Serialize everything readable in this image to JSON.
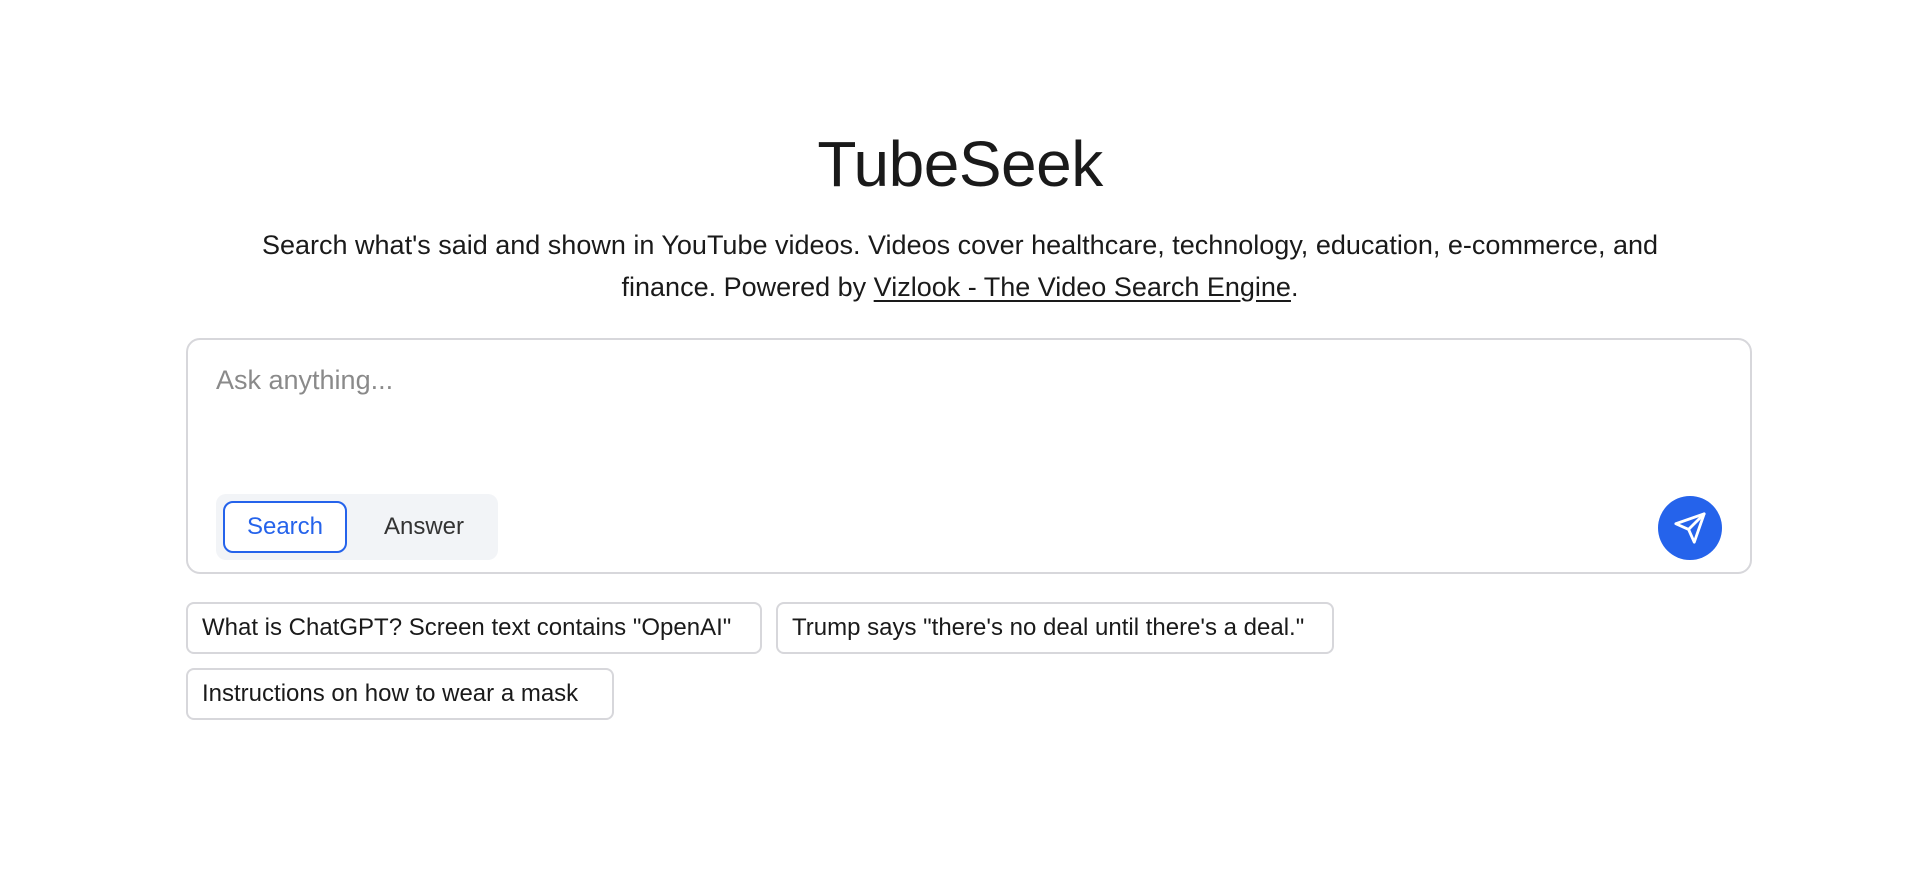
{
  "header": {
    "title": "TubeSeek",
    "description_prefix": "Search what's said and shown in YouTube videos. Videos cover healthcare, technology, education, e-commerce, and finance. Powered by ",
    "link_text": "Vizlook - The Video Search Engine",
    "description_suffix": "."
  },
  "composer": {
    "placeholder": "Ask anything...",
    "value": "",
    "modes": {
      "search_label": "Search",
      "answer_label": "Answer",
      "selected": "Search"
    },
    "send_icon": "paper-plane-icon"
  },
  "suggestions": [
    {
      "label": "What is ChatGPT? Screen text contains \"OpenAI\""
    },
    {
      "label": "Trump says \"there's no deal until there's a deal.\""
    },
    {
      "label": "Instructions on how to wear a mask"
    }
  ],
  "colors": {
    "accent": "#2563eb",
    "border": "#d7d7db",
    "toggle_bg": "#f2f4f7",
    "text": "#1a1a1a",
    "placeholder": "#8a8a8a"
  }
}
